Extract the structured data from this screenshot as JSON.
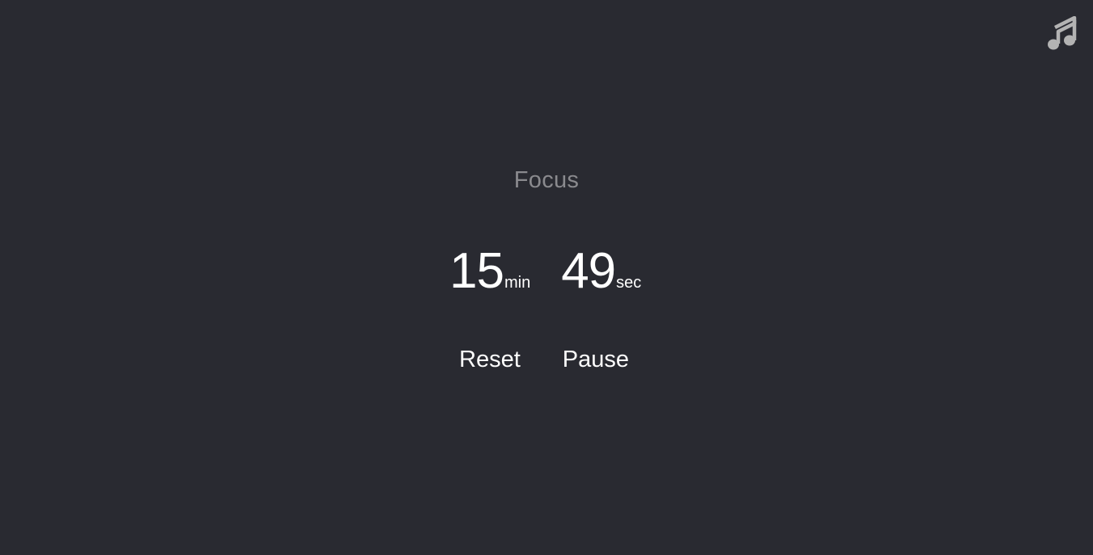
{
  "mode": {
    "label": "Focus"
  },
  "timer": {
    "minutes": "15",
    "minutes_unit": "min",
    "seconds": "49",
    "seconds_unit": "sec"
  },
  "controls": {
    "reset_label": "Reset",
    "pause_label": "Pause"
  },
  "toolbar": {
    "music_icon": "music-note-icon"
  },
  "colors": {
    "background": "#292a31",
    "text": "#ffffff",
    "muted": "#8a8a8e",
    "icon": "#b3b3b3"
  }
}
